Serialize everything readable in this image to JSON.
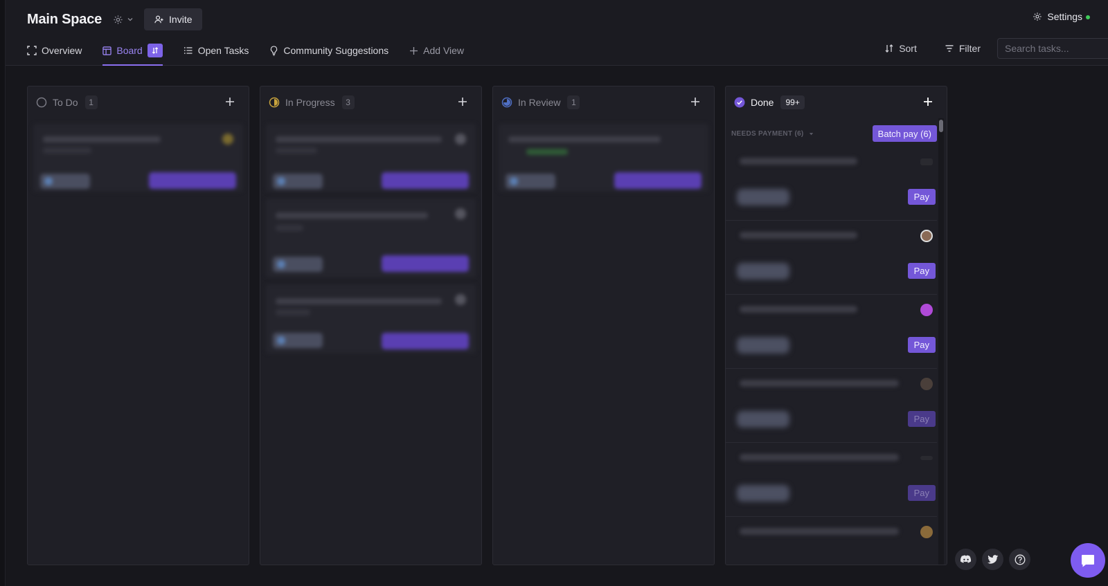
{
  "header": {
    "space_title": "Main Space",
    "invite_label": "Invite",
    "settings_label": "Settings"
  },
  "tabs": [
    {
      "label": "Overview",
      "icon": "expand-icon"
    },
    {
      "label": "Board",
      "icon": "board-icon",
      "active": true
    },
    {
      "label": "Open Tasks",
      "icon": "list-icon"
    },
    {
      "label": "Community Suggestions",
      "icon": "lightbulb-icon"
    },
    {
      "label": "Add View",
      "icon": "plus-icon"
    }
  ],
  "toolbar": {
    "sort_label": "Sort",
    "filter_label": "Filter",
    "search_placeholder": "Search tasks..."
  },
  "columns": [
    {
      "title": "To Do",
      "count": "1"
    },
    {
      "title": "In Progress",
      "count": "3"
    },
    {
      "title": "In Review",
      "count": "1"
    },
    {
      "title": "Done",
      "count": "99+"
    }
  ],
  "done": {
    "group_label": "NEEDS PAYMENT (6)",
    "batch_pay_label": "Batch pay (6)",
    "pay_label": "Pay"
  },
  "colors": {
    "accent": "#7457d8",
    "background": "#17171c",
    "status_online": "#3fca5a"
  }
}
